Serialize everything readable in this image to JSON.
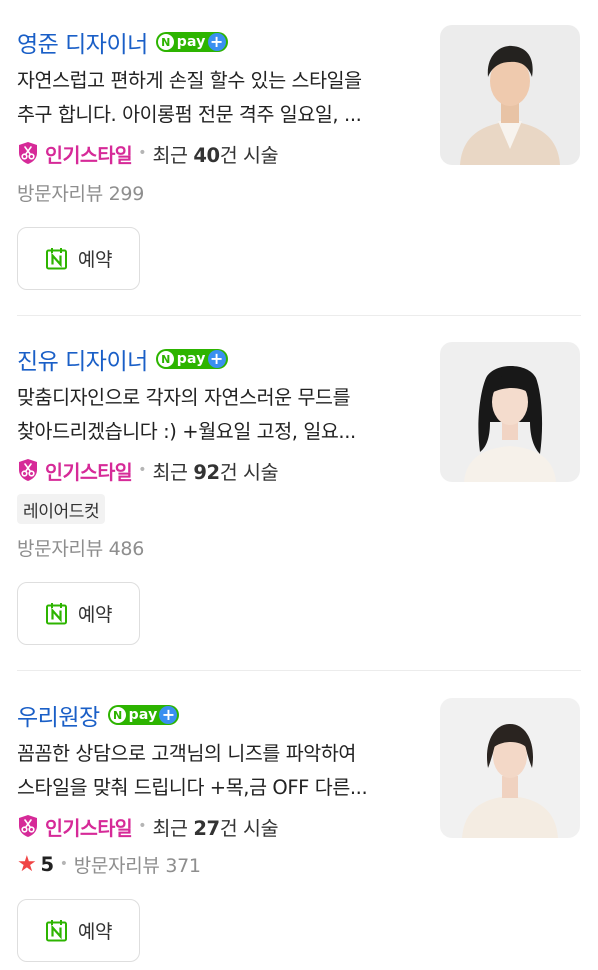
{
  "colors": {
    "name_link": "#1a5fc7",
    "popular_pink": "#d62a98",
    "npay_green": "#2db400",
    "npay_plus_blue": "#3a8ff0",
    "star_red": "#f04444",
    "reserve_icon_green": "#2db400"
  },
  "npay": {
    "n": "N",
    "pay": "pay",
    "plus": "+"
  },
  "designers": [
    {
      "name": "영준 디자이너",
      "description_line1": "자연스럽고 편하게 손질 할수 있는 스타일을",
      "description_line2": "추구 합니다. 아이롱펌 전문 격주 일요일, ...",
      "popular_label": "인기스타일",
      "recent_prefix": "최근 ",
      "recent_count": "40",
      "recent_suffix": "건 시술",
      "tag": null,
      "rating": null,
      "review_text": "방문자리뷰 299",
      "reserve_label": "예약",
      "photo_icon": "male-designer-photo"
    },
    {
      "name": "진유 디자이너",
      "description_line1": "맞춤디자인으로 각자의 자연스러운 무드를",
      "description_line2": "찾아드리겠습니다 :) +월요일 고정, 일요...",
      "popular_label": "인기스타일",
      "recent_prefix": "최근 ",
      "recent_count": "92",
      "recent_suffix": "건 시술",
      "tag": "레이어드컷",
      "rating": null,
      "review_text": "방문자리뷰 486",
      "reserve_label": "예약",
      "photo_icon": "female-designer-photo"
    },
    {
      "name": "우리원장",
      "description_line1": "꼼꼼한 상담으로 고객님의 니즈를 파악하여",
      "description_line2": "스타일을 맞춰 드립니다 +목,금 OFF 다른...",
      "popular_label": "인기스타일",
      "recent_prefix": "최근 ",
      "recent_count": "27",
      "recent_suffix": "건 시술",
      "tag": null,
      "rating": "5",
      "review_text": "방문자리뷰 371",
      "reserve_label": "예약",
      "photo_icon": "female-director-photo"
    }
  ]
}
